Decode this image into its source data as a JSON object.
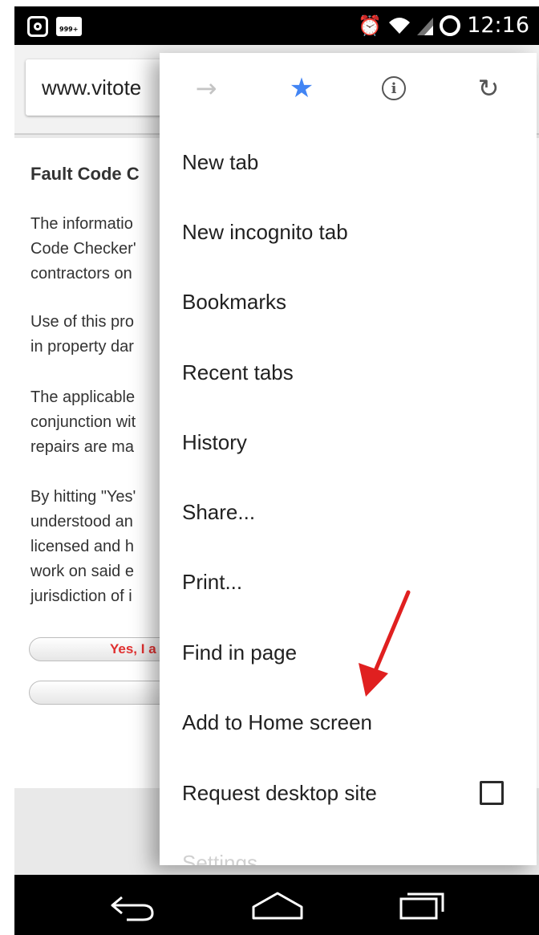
{
  "status_bar": {
    "left_icons": [
      "instagram-icon",
      "notification-999-icon"
    ],
    "notification_badge": "999+",
    "right_icons": [
      "alarm-icon",
      "wifi-icon",
      "signal-icon",
      "battery-icon"
    ],
    "time": "12:16"
  },
  "browser": {
    "url": "www.vitote",
    "page": {
      "heading": "Fault Code C",
      "paragraphs": [
        "The informatio\nCode Checker'\ncontractors on",
        "Use of this pro\nin property dar",
        "The applicable\nconjunction wit\nrepairs are ma",
        "By hitting \"Yes'\nunderstood an\nlicensed and h\nwork on said e\njurisdiction of i"
      ],
      "yes_button_label": "Yes, I a",
      "second_button_label": ""
    }
  },
  "menu": {
    "icon_row": {
      "forward": "forward-icon",
      "bookmark": "star-icon",
      "info": "info-icon",
      "reload": "reload-icon"
    },
    "items": [
      {
        "label": "New tab"
      },
      {
        "label": "New incognito tab"
      },
      {
        "label": "Bookmarks"
      },
      {
        "label": "Recent tabs"
      },
      {
        "label": "History"
      },
      {
        "label": "Share..."
      },
      {
        "label": "Print..."
      },
      {
        "label": "Find in page"
      },
      {
        "label": "Add to Home screen"
      },
      {
        "label": "Request desktop site",
        "checked": false
      },
      {
        "label": "Settings"
      }
    ]
  },
  "annotation": {
    "type": "arrow",
    "color": "#e02020",
    "points_to": "Add to Home screen"
  },
  "nav_bar": [
    "back-icon",
    "home-icon",
    "recents-icon"
  ],
  "colors": {
    "accent_star": "#4285f4",
    "status_bar": "#000000",
    "arrow": "#e02020"
  }
}
